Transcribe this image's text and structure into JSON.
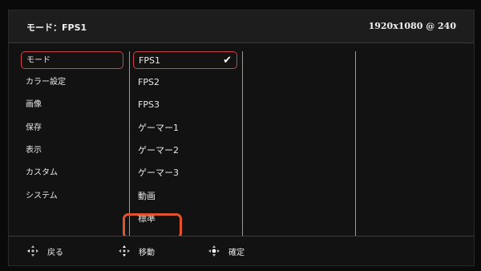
{
  "header": {
    "title": "モード：FPS1",
    "resolution": "1920x1080 @ 240"
  },
  "sidebar": {
    "items": [
      {
        "label": "モード",
        "selected": true
      },
      {
        "label": "カラー設定"
      },
      {
        "label": "画像"
      },
      {
        "label": "保存"
      },
      {
        "label": "表示"
      },
      {
        "label": "カスタム"
      },
      {
        "label": "システム"
      }
    ]
  },
  "modes": {
    "items": [
      {
        "label": "FPS1",
        "selected": true,
        "checked": true
      },
      {
        "label": "FPS2"
      },
      {
        "label": "FPS3"
      },
      {
        "label": "ゲーマー1"
      },
      {
        "label": "ゲーマー2"
      },
      {
        "label": "ゲーマー3"
      },
      {
        "label": "動画"
      },
      {
        "label": "標準",
        "highlighted_callout": true
      }
    ]
  },
  "footer": {
    "back_label": "戻る",
    "move_label": "移動",
    "confirm_label": "確定"
  },
  "icons": {
    "checkmark": "check-icon",
    "dpad": "dpad-icon"
  },
  "colors": {
    "selection_border": "#c9444a",
    "callout": "#e2532b"
  }
}
